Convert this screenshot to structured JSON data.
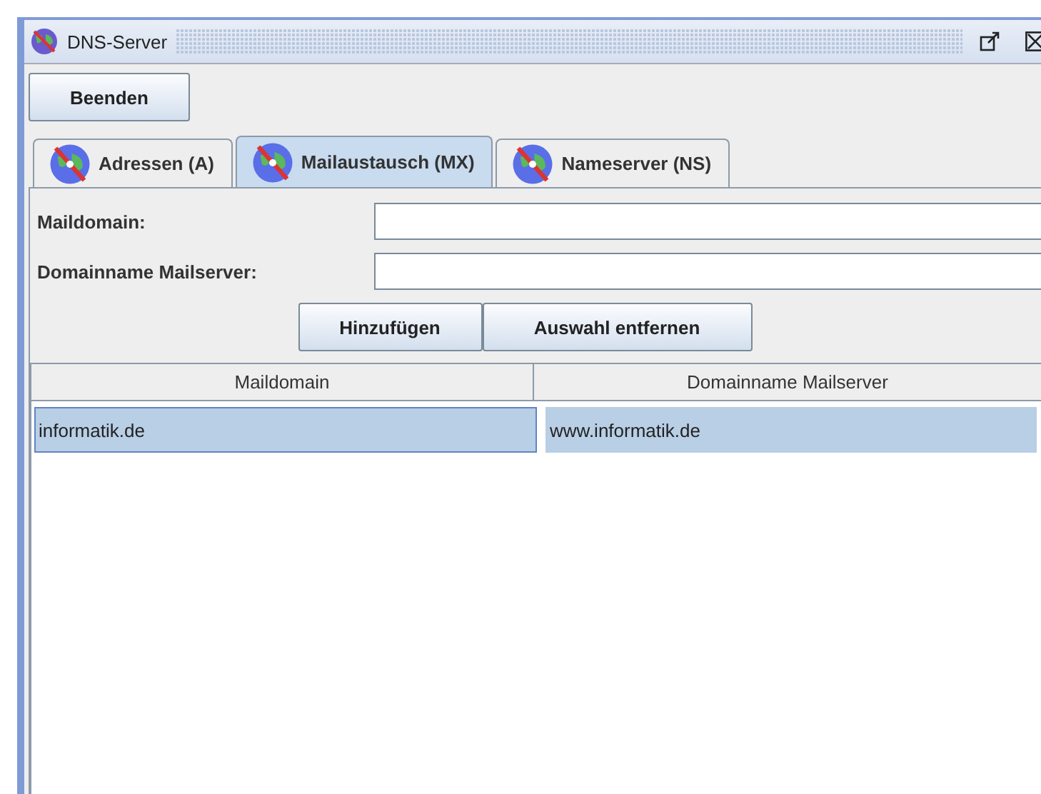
{
  "window": {
    "title": "DNS-Server"
  },
  "toolbar": {
    "buttons": [
      "Beenden"
    ]
  },
  "tabs": [
    {
      "label": "Adressen (A)",
      "selected": false
    },
    {
      "label": "Mailaustausch (MX)",
      "selected": true
    },
    {
      "label": "Nameserver (NS)",
      "selected": false
    }
  ],
  "form": {
    "fields": [
      {
        "label": "Maildomain:"
      },
      {
        "label": "Domainname Mailserver:"
      }
    ],
    "buttons": [
      "Hinzufügen",
      "Auswahl entfernen"
    ]
  },
  "table": {
    "columns": [
      "Maildomain",
      "Domainname Mailserver"
    ],
    "rows": [
      {
        "selected": true,
        "cells": [
          {
            "text": "informatik.de",
            "focused": true
          },
          {
            "text": "www.informatik.de",
            "focused": false
          }
        ]
      }
    ]
  }
}
